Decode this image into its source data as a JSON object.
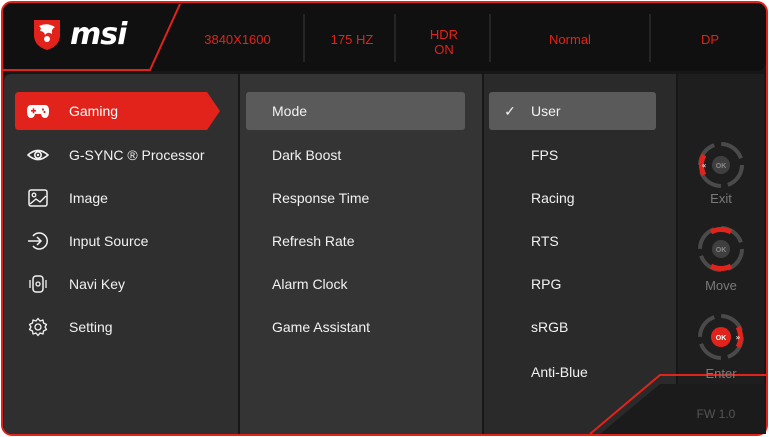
{
  "brand": {
    "logo_text": "msi"
  },
  "header": {
    "resolution": "3840X1600",
    "refresh": "175 HZ",
    "hdr_line1": "HDR",
    "hdr_line2": "ON",
    "mode": "Normal",
    "input": "DP"
  },
  "menu": {
    "items": [
      {
        "label": "Gaming",
        "icon": "gamepad-icon"
      },
      {
        "label": "G-SYNC ® Processor",
        "icon": "eye-icon"
      },
      {
        "label": "Image",
        "icon": "image-icon"
      },
      {
        "label": "Input Source",
        "icon": "input-source-icon"
      },
      {
        "label": "Navi Key",
        "icon": "navi-key-icon"
      },
      {
        "label": "Setting",
        "icon": "gear-icon"
      }
    ],
    "active_index": 0
  },
  "submenu": {
    "items": [
      "Mode",
      "Dark Boost",
      "Response Time",
      "Refresh Rate",
      "Alarm Clock",
      "Game Assistant"
    ],
    "active_index": 0
  },
  "options": {
    "items": [
      "User",
      "FPS",
      "Racing",
      "RTS",
      "RPG",
      "sRGB",
      "Anti-Blue"
    ],
    "selected_index": 0,
    "check_glyph": "✓"
  },
  "keys": {
    "exit_label": "Exit",
    "move_label": "Move",
    "enter_label": "Enter",
    "ok_text": "OK"
  },
  "firmware": "FW 1.0",
  "colors": {
    "accent_red": "#e1231b",
    "panel_dark": "#2b2b2b",
    "panel_mid": "#3a3a3a",
    "selected_bg": "#5a5a5a",
    "background": "#1a1a1a"
  }
}
